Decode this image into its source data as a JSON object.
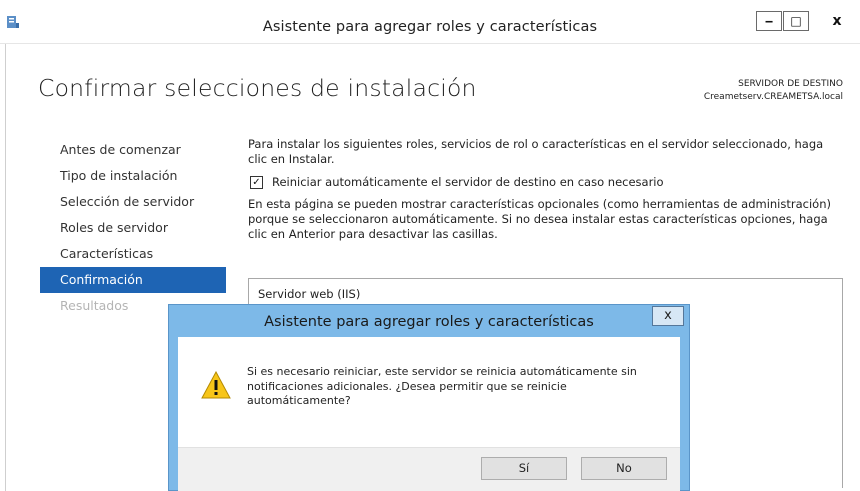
{
  "window": {
    "title": "Asistente para agregar roles y características",
    "minimize": "‒",
    "maximize": "□",
    "close": "x"
  },
  "header": {
    "title": "Confirmar selecciones de instalación",
    "dest_label": "SERVIDOR DE DESTINO",
    "dest_server": "Creametserv.CREAMETSA.local"
  },
  "nav": {
    "items": [
      {
        "label": "Antes de comenzar",
        "state": "normal"
      },
      {
        "label": "Tipo de instalación",
        "state": "normal"
      },
      {
        "label": "Selección de servidor",
        "state": "normal"
      },
      {
        "label": "Roles de servidor",
        "state": "normal"
      },
      {
        "label": "Características",
        "state": "normal"
      },
      {
        "label": "Confirmación",
        "state": "active"
      },
      {
        "label": "Resultados",
        "state": "disabled"
      }
    ]
  },
  "content": {
    "intro": "Para instalar los siguientes roles, servicios de rol o características en el servidor seleccionado, haga clic en Instalar.",
    "restart_checkbox": {
      "label": "Reiniciar automáticamente el servidor de destino en caso necesario",
      "checked": true,
      "mark": "✓"
    },
    "optional_text": "En esta página se pueden mostrar características opcionales (como herramientas de administración) porque se seleccionaron automáticamente. Si no desea instalar estas características opciones, haga clic en Anterior para desactivar las casillas.",
    "list": [
      "Servidor web (IIS)"
    ]
  },
  "dialog": {
    "title": "Asistente para agregar roles y características",
    "close": "x",
    "message": "Si es necesario reiniciar, este servidor se reinicia automáticamente sin notificaciones adicionales. ¿Desea permitir que se reinicie automáticamente?",
    "icon": "warning-icon",
    "yes_label": "Sí",
    "no_label": "No"
  },
  "colors": {
    "active_nav": "#1e64b4",
    "dialog_frame": "#7db9e8"
  }
}
